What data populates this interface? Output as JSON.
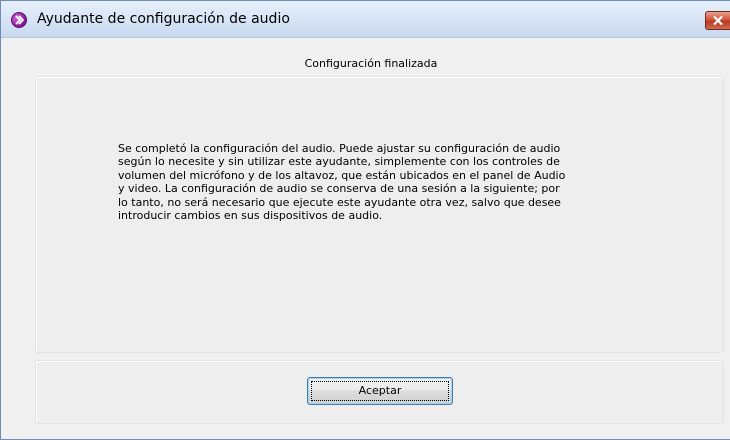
{
  "window": {
    "title": "Ayudante de configuración de audio",
    "app_icon": "chevron-right-icon",
    "close_icon": "close-icon",
    "accent_color": "#c9472c"
  },
  "heading": "Configuración finalizada",
  "message": {
    "lines": [
      "Se completó la configuración del audio.  Puede ajustar su configuración de audio",
      "según lo necesite y sin utilizar este ayudante, simplemente con los controles de",
      "volumen del micrófono y de los altavoz, que están ubicados en el panel de Audio",
      "y video. La configuración de audio se conserva de una sesión a la siguiente; por",
      "lo tanto, no será necesario que ejecute este ayudante otra vez, salvo que desee",
      "introducir cambios en sus dispositivos de audio."
    ]
  },
  "buttons": {
    "ok_label": "Aceptar"
  }
}
